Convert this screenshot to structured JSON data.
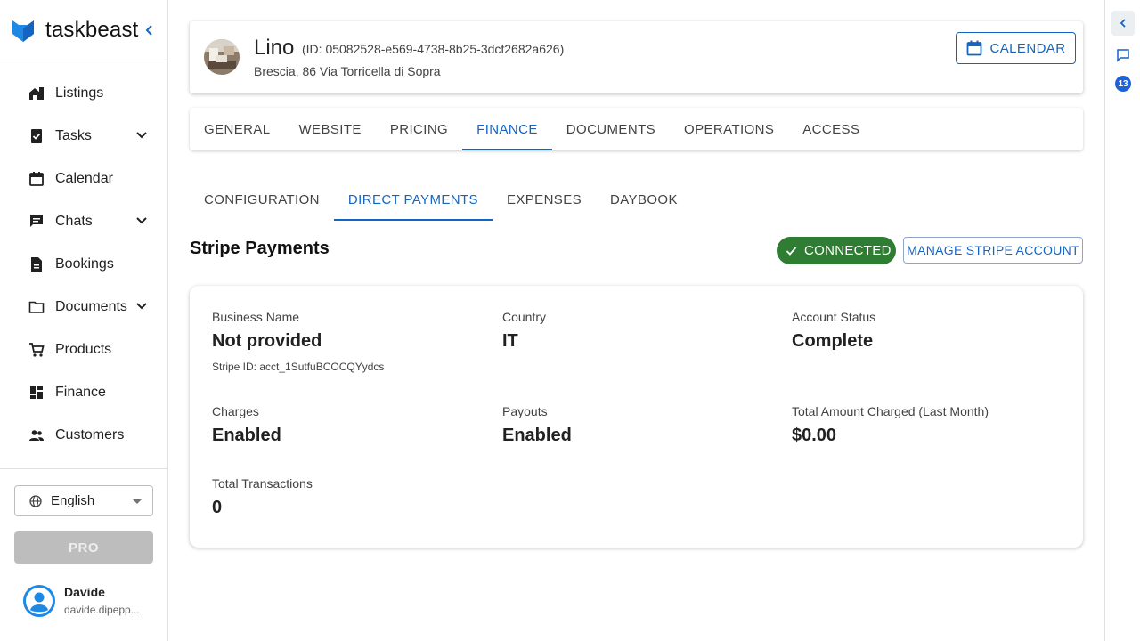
{
  "brand": {
    "name": "taskbeast"
  },
  "sidebar": {
    "items": [
      {
        "label": "Listings",
        "icon": "listings-icon",
        "expandable": false
      },
      {
        "label": "Tasks",
        "icon": "tasks-icon",
        "expandable": true
      },
      {
        "label": "Calendar",
        "icon": "calendar-icon",
        "expandable": false
      },
      {
        "label": "Chats",
        "icon": "chat-icon",
        "expandable": true
      },
      {
        "label": "Bookings",
        "icon": "bookings-icon",
        "expandable": false
      },
      {
        "label": "Documents",
        "icon": "folder-icon",
        "expandable": true
      },
      {
        "label": "Products",
        "icon": "cart-icon",
        "expandable": false
      },
      {
        "label": "Finance",
        "icon": "dashboard-icon",
        "expandable": false
      },
      {
        "label": "Customers",
        "icon": "people-icon",
        "expandable": false
      }
    ],
    "language": "English",
    "pro_label": "PRO",
    "user": {
      "name": "Davide",
      "email": "davide.dipepp..."
    }
  },
  "right_rail": {
    "badge_count": "13"
  },
  "listing": {
    "name": "Lino",
    "id_text": "(ID: 05082528-e569-4738-8b25-3dcf2682a626)",
    "address": "Brescia, 86 Via Torricella di Sopra",
    "calendar_label": "CALENDAR"
  },
  "tabs": [
    "GENERAL",
    "WEBSITE",
    "PRICING",
    "FINANCE",
    "DOCUMENTS",
    "OPERATIONS",
    "ACCESS"
  ],
  "active_tab": "FINANCE",
  "subtabs": [
    "CONFIGURATION",
    "DIRECT PAYMENTS",
    "EXPENSES",
    "DAYBOOK"
  ],
  "active_subtab": "DIRECT PAYMENTS",
  "stripe": {
    "title": "Stripe Payments",
    "status": "CONNECTED",
    "manage_label": "MANAGE STRIPE ACCOUNT",
    "business_name_label": "Business Name",
    "business_name": "Not provided",
    "stripe_id": "Stripe ID: acct_1SutfuBCOCQYydcs",
    "country_label": "Country",
    "country": "IT",
    "account_status_label": "Account Status",
    "account_status": "Complete",
    "charges_label": "Charges",
    "charges": "Enabled",
    "payouts_label": "Payouts",
    "payouts": "Enabled",
    "total_charged_label": "Total Amount Charged (Last Month)",
    "total_charged": "$0.00",
    "total_transactions_label": "Total Transactions",
    "total_transactions": "0"
  },
  "colors": {
    "primary": "#1565c0",
    "success": "#2e7d32",
    "disabled": "#bdbdbd"
  }
}
